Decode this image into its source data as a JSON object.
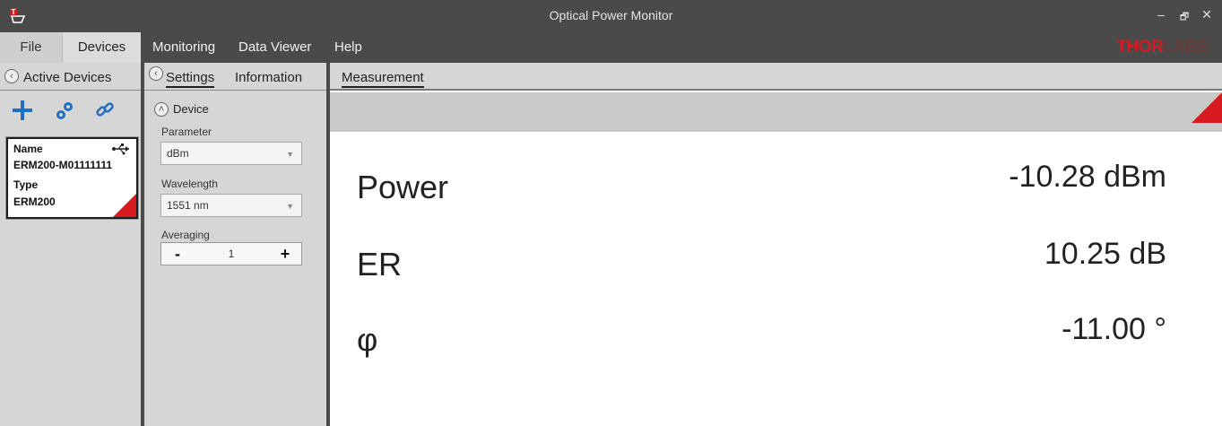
{
  "window": {
    "title": "Optical Power Monitor",
    "minimize": "–",
    "restore": "🗗",
    "close": "✕"
  },
  "menu": {
    "items": [
      "File",
      "Devices",
      "Monitoring",
      "Data Viewer",
      "Help"
    ],
    "logo_thor": "THOR",
    "logo_labs": "LABS"
  },
  "active_devices": {
    "title": "Active Devices",
    "device": {
      "name_label": "Name",
      "name_value": "ERM200-M01111111",
      "type_label": "Type",
      "type_value": "ERM200"
    }
  },
  "settings": {
    "tabs": [
      "Settings",
      "Information"
    ],
    "section": "Device",
    "parameter_label": "Parameter",
    "parameter_value": "dBm",
    "wavelength_label": "Wavelength",
    "wavelength_value": "1551 nm",
    "averaging_label": "Averaging",
    "averaging_value": "1",
    "minus": "-",
    "plus": "+"
  },
  "measurement": {
    "tab": "Measurement",
    "rows": [
      {
        "label": "Power",
        "value": "-10.28 dBm"
      },
      {
        "label": "ER",
        "value": "10.25 dB"
      },
      {
        "label": "φ",
        "value": "-11.00 °"
      }
    ]
  },
  "colors": {
    "accent_red": "#d71920",
    "icon_blue": "#1f6fc5",
    "chrome_dark": "#4a4a4a"
  }
}
